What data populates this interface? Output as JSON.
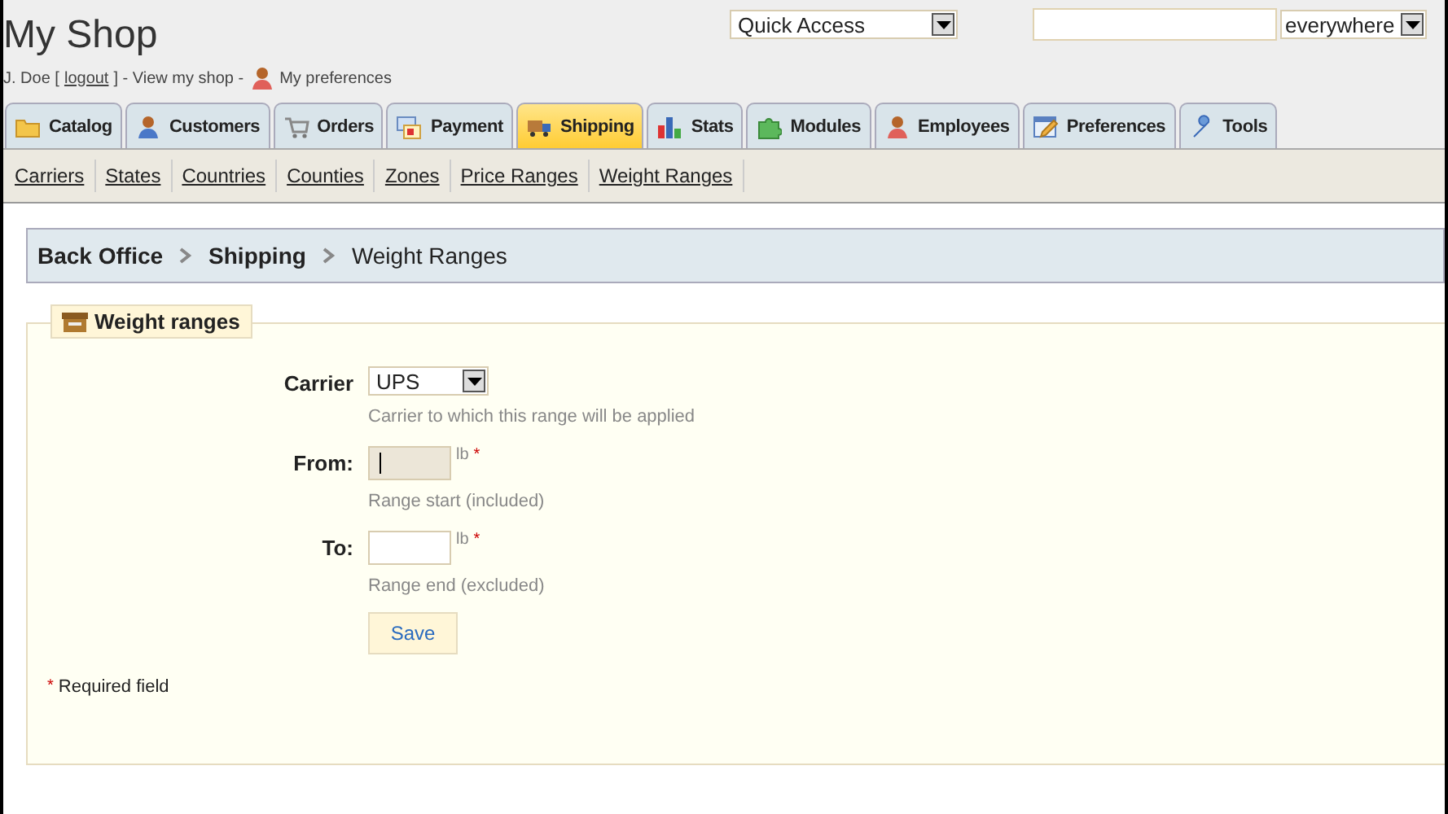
{
  "header": {
    "title": "My Shop",
    "quick_access": "Quick Access",
    "search_scope": "everywhere",
    "user_line": {
      "name": "J. Doe [",
      "logout": "logout",
      "after": "] - View my shop -",
      "preferences": "My preferences"
    }
  },
  "tabs": [
    {
      "label": "Catalog",
      "selected": false
    },
    {
      "label": "Customers",
      "selected": false
    },
    {
      "label": "Orders",
      "selected": false
    },
    {
      "label": "Payment",
      "selected": false
    },
    {
      "label": "Shipping",
      "selected": true
    },
    {
      "label": "Stats",
      "selected": false
    },
    {
      "label": "Modules",
      "selected": false
    },
    {
      "label": "Employees",
      "selected": false
    },
    {
      "label": "Preferences",
      "selected": false
    },
    {
      "label": "Tools",
      "selected": false
    }
  ],
  "subtabs": [
    "Carriers",
    "States",
    "Countries",
    "Counties",
    "Zones",
    "Price Ranges",
    "Weight Ranges"
  ],
  "breadcrumb": [
    "Back Office",
    "Shipping",
    "Weight Ranges"
  ],
  "form": {
    "legend": "Weight ranges",
    "fields": [
      {
        "kind": "select",
        "label": "Carrier",
        "value": "UPS",
        "hint": "Carrier to which this range will be applied"
      },
      {
        "kind": "input",
        "label": "From:",
        "focused": true,
        "unit": "lb",
        "required": "*",
        "hint": "Range start (included)"
      },
      {
        "kind": "input",
        "label": "To:",
        "focused": false,
        "unit": "lb",
        "required": "*",
        "hint": "Range end (excluded)"
      }
    ],
    "submit": "Save",
    "required_note": {
      "mark": "*",
      "text": "Required field"
    }
  }
}
